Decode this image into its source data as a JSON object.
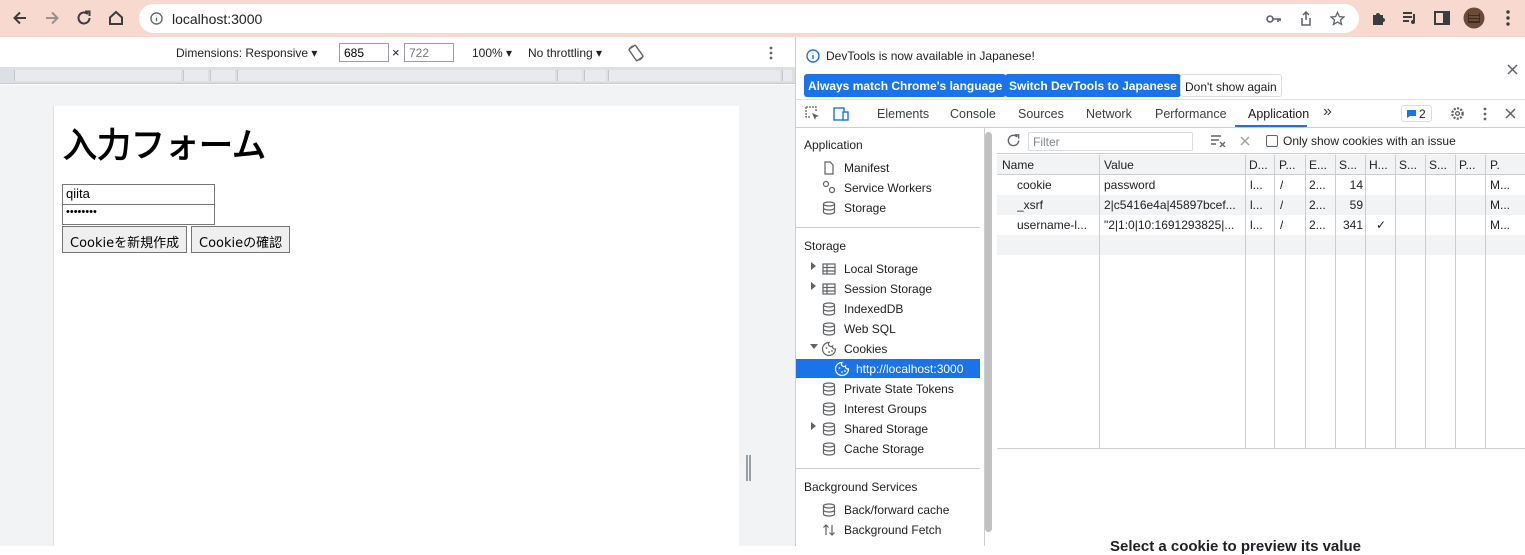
{
  "browser": {
    "url": "localhost:3000",
    "colors": {
      "frame": "#f8d9cf",
      "accent": "#1a73e8"
    }
  },
  "device_toolbar": {
    "dimensions_label": "Dimensions: Responsive",
    "width": "685",
    "height_placeholder": "722",
    "times": "×",
    "zoom": "100%",
    "throttling": "No throttling"
  },
  "page": {
    "heading": "入力フォーム",
    "username_value": "qiita",
    "password_value": "••••••••",
    "create_button": "Cookieを新規作成",
    "check_button": "Cookieの確認"
  },
  "devtools": {
    "infobar": {
      "message": "DevTools is now available in Japanese!",
      "btn_match": "Always match Chrome's language",
      "btn_switch": "Switch DevTools to Japanese",
      "btn_dont": "Don't show again"
    },
    "tabs": {
      "elements": "Elements",
      "console": "Console",
      "sources": "Sources",
      "network": "Network",
      "performance": "Performance",
      "application": "Application",
      "more": "»",
      "issues_count": "2"
    },
    "sidebar": {
      "application_header": "Application",
      "manifest": "Manifest",
      "service_workers": "Service Workers",
      "storage_item": "Storage",
      "storage_header": "Storage",
      "local_storage": "Local Storage",
      "session_storage": "Session Storage",
      "indexeddb": "IndexedDB",
      "web_sql": "Web SQL",
      "cookies": "Cookies",
      "cookie_origin": "http://localhost:3000",
      "private_state_tokens": "Private State Tokens",
      "interest_groups": "Interest Groups",
      "shared_storage": "Shared Storage",
      "cache_storage": "Cache Storage",
      "bg_header": "Background Services",
      "bfcache": "Back/forward cache",
      "bg_fetch": "Background Fetch"
    },
    "cookies_panel": {
      "filter_placeholder": "Filter",
      "only_issues": "Only show cookies with an issue",
      "columns": [
        "Name",
        "Value",
        "D...",
        "P...",
        "E...",
        "S...",
        "H...",
        "S...",
        "S...",
        "P...",
        "P."
      ],
      "rows": [
        [
          "cookie",
          "password",
          "l...",
          "/",
          "2...",
          "14",
          "",
          "",
          "",
          "",
          "M..."
        ],
        [
          "_xsrf",
          "2|c5416e4a|45897bcef...",
          "l...",
          "/",
          "2...",
          "59",
          "",
          "",
          "",
          "",
          "M..."
        ],
        [
          "username-l...",
          "\"2|1:0|10:1691293825|...",
          "l...",
          "/",
          "2...",
          "341",
          "✓",
          "",
          "",
          "",
          "M..."
        ]
      ],
      "select_hint": "Select a cookie to preview its value"
    }
  }
}
